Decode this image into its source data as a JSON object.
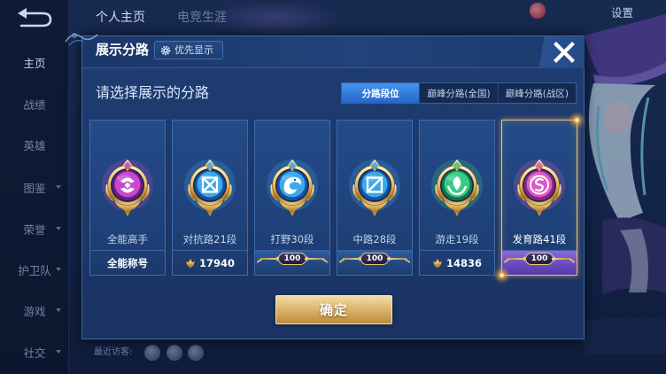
{
  "top_bar": {
    "back_icon": "back-arrow-icon",
    "tabs": [
      {
        "label": "个人主页",
        "selected": true
      },
      {
        "label": "电竞生涯"
      }
    ],
    "settings_label": "设置"
  },
  "sidebar": {
    "items": [
      {
        "label": "主页",
        "active": true
      },
      {
        "label": "战绩"
      },
      {
        "label": "英雄"
      },
      {
        "label": "图鉴",
        "expandable": true
      },
      {
        "label": "荣誉",
        "expandable": true
      },
      {
        "label": "护卫队",
        "expandable": true
      },
      {
        "label": "游戏",
        "expandable": true
      },
      {
        "label": "社交",
        "expandable": true
      }
    ]
  },
  "footer": {
    "recent_visitors_label": "最近访客:"
  },
  "modal": {
    "title": "展示分路",
    "priority_button": {
      "label": "优先显示",
      "icon": "gear-icon"
    },
    "close_icon": "close-icon",
    "prompt": "请选择展示的分路",
    "tabs": [
      {
        "label": "分路段位",
        "selected": true
      },
      {
        "label": "巅峰分路(全国)"
      },
      {
        "label": "巅峰分路(战区)"
      }
    ],
    "cards": [
      {
        "name": "全能高手",
        "footer": "全能称号",
        "icon": "all-round-lane-icon",
        "emblem_color": "#d04fd6",
        "emblem_color_dark": "#6e1885"
      },
      {
        "name": "对抗路21段",
        "footer": "17940",
        "footer_icon": "score-icon",
        "icon": "clash-lane-icon",
        "emblem_color": "#41b2f0",
        "emblem_color_dark": "#14519f"
      },
      {
        "name": "打野30段",
        "footer": "100",
        "footer_icon": "rank-badge",
        "icon": "jungle-lane-icon",
        "emblem_color": "#41b2f0",
        "emblem_color_dark": "#14519f"
      },
      {
        "name": "中路28段",
        "footer": "100",
        "footer_icon": "rank-badge",
        "icon": "mid-lane-icon",
        "emblem_color": "#41b2f0",
        "emblem_color_dark": "#14519f"
      },
      {
        "name": "游走19段",
        "footer": "14836",
        "footer_icon": "score-icon",
        "icon": "roam-lane-icon",
        "emblem_color": "#3fd48c",
        "emblem_color_dark": "#11754a"
      },
      {
        "name": "发育路41段",
        "footer": "100",
        "footer_icon": "rank-badge",
        "icon": "farm-lane-icon",
        "emblem_color": "#e660c6",
        "emblem_color_dark": "#86238a",
        "selected": true
      }
    ],
    "confirm_label": "确定"
  },
  "colors": {
    "panel": "#1d3a6c",
    "tab_selected": "#2f7ae0",
    "selected_border": "#eac173",
    "confirm_gold": "#dcb36a"
  }
}
